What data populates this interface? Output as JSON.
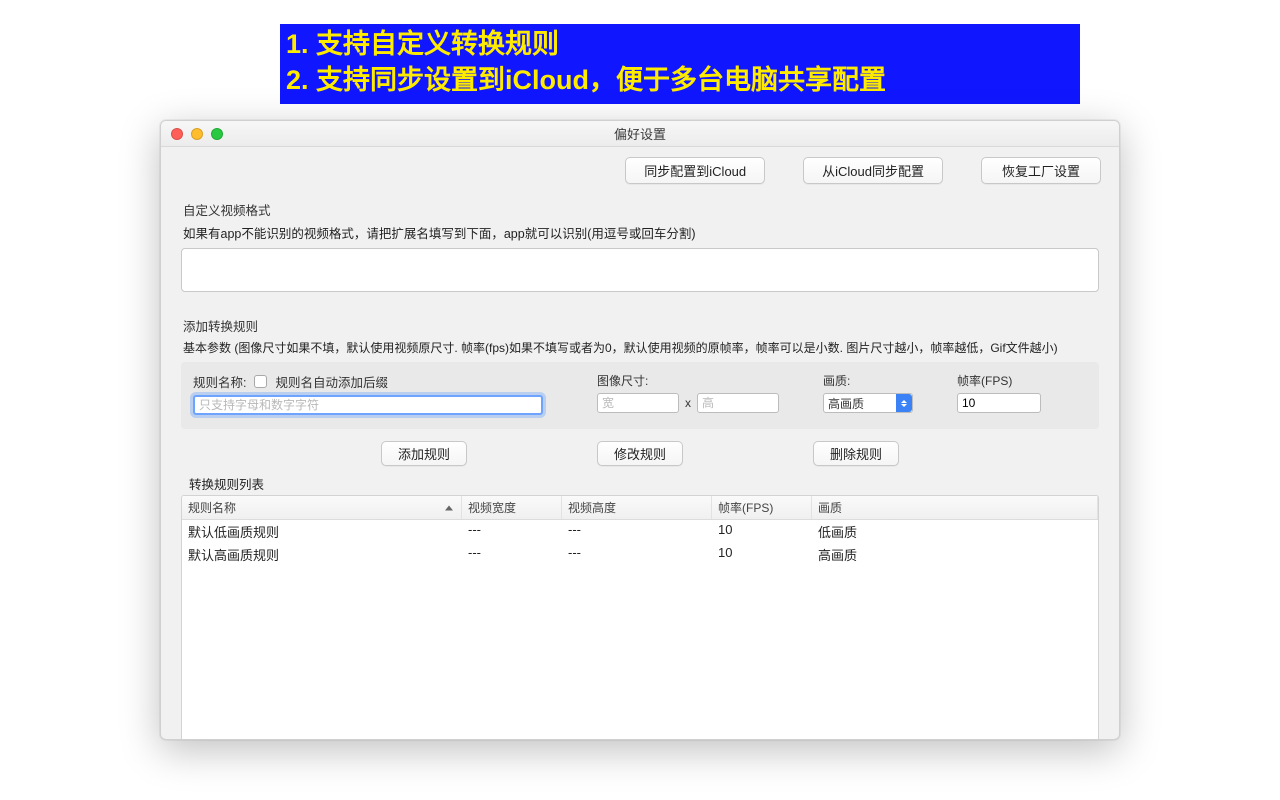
{
  "banner": {
    "line1": "1. 支持自定义转换规则",
    "line2": "2. 支持同步设置到iCloud，便于多台电脑共享配置"
  },
  "window": {
    "title": "偏好设置",
    "toolbar": {
      "sync_to_icloud": "同步配置到iCloud",
      "sync_from_icloud": "从iCloud同步配置",
      "restore_factory": "恢复工厂设置"
    },
    "custom_format": {
      "label": "自定义视频格式",
      "hint": "如果有app不能识别的视频格式，请把扩展名填写到下面，app就可以识别(用逗号或回车分割)",
      "value": ""
    },
    "add_rule": {
      "title": "添加转换规则",
      "desc": "基本参数 (图像尺寸如果不填，默认使用视频原尺寸. 帧率(fps)如果不填写或者为0，默认使用视频的原帧率，帧率可以是小数. 图片尺寸越小，帧率越低，Gif文件越小)",
      "name_label": "规则名称:",
      "auto_suffix_label": "规则名自动添加后缀",
      "name_placeholder": "只支持字母和数字字符",
      "name_value": "",
      "size_label": "图像尺寸:",
      "width_placeholder": "宽",
      "width_value": "",
      "x": "x",
      "height_placeholder": "高",
      "height_value": "",
      "quality_label": "画质:",
      "quality_value": "高画质",
      "fps_label": "帧率(FPS)",
      "fps_value": "10"
    },
    "actions": {
      "add": "添加规则",
      "modify": "修改规则",
      "delete": "删除规则"
    },
    "rule_list": {
      "label": "转换规则列表",
      "headers": {
        "name": "规则名称",
        "width": "视频宽度",
        "height": "视频高度",
        "fps": "帧率(FPS)",
        "quality": "画质"
      },
      "rows": [
        {
          "name": "默认低画质规则",
          "width": "---",
          "height": "---",
          "fps": "10",
          "quality": "低画质"
        },
        {
          "name": "默认高画质规则",
          "width": "---",
          "height": "---",
          "fps": "10",
          "quality": "高画质"
        }
      ]
    }
  }
}
